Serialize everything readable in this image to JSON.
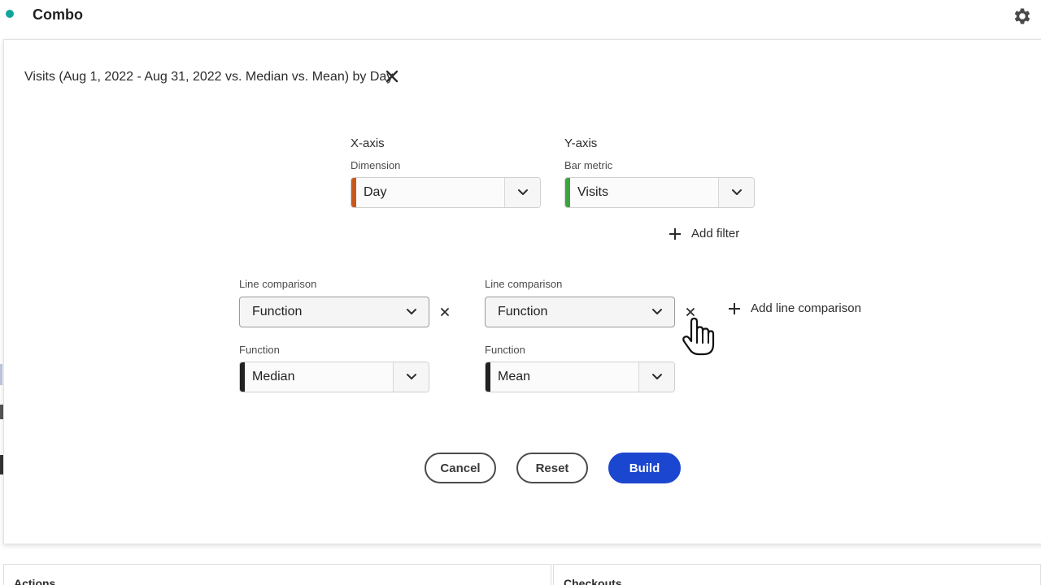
{
  "header": {
    "app_title": "Combo",
    "status_dot_color": "#12a59c",
    "settings_icon": "gear-icon"
  },
  "modal": {
    "title": "Visits (Aug 1, 2022 - Aug 31, 2022 vs. Median vs. Mean) by Day",
    "close_icon": "close-icon",
    "x_axis": {
      "heading": "X-axis",
      "label": "Dimension",
      "value": "Day",
      "accent_color": "#c8571e"
    },
    "y_axis": {
      "heading": "Y-axis",
      "label": "Bar metric",
      "value": "Visits",
      "accent_color": "#3aa53d"
    },
    "add_filter_label": "Add filter",
    "line_comparisons": [
      {
        "label": "Line comparison",
        "type_value": "Function",
        "function_label": "Function",
        "function_value": "Median"
      },
      {
        "label": "Line comparison",
        "type_value": "Function",
        "function_label": "Function",
        "function_value": "Mean"
      }
    ],
    "add_line_comparison_label": "Add line comparison",
    "buttons": {
      "cancel": "Cancel",
      "reset": "Reset",
      "build": "Build"
    },
    "primary_color": "#1b46d0"
  },
  "background": {
    "panel_left_label": "Actions",
    "panel_right_label": "Checkouts"
  }
}
